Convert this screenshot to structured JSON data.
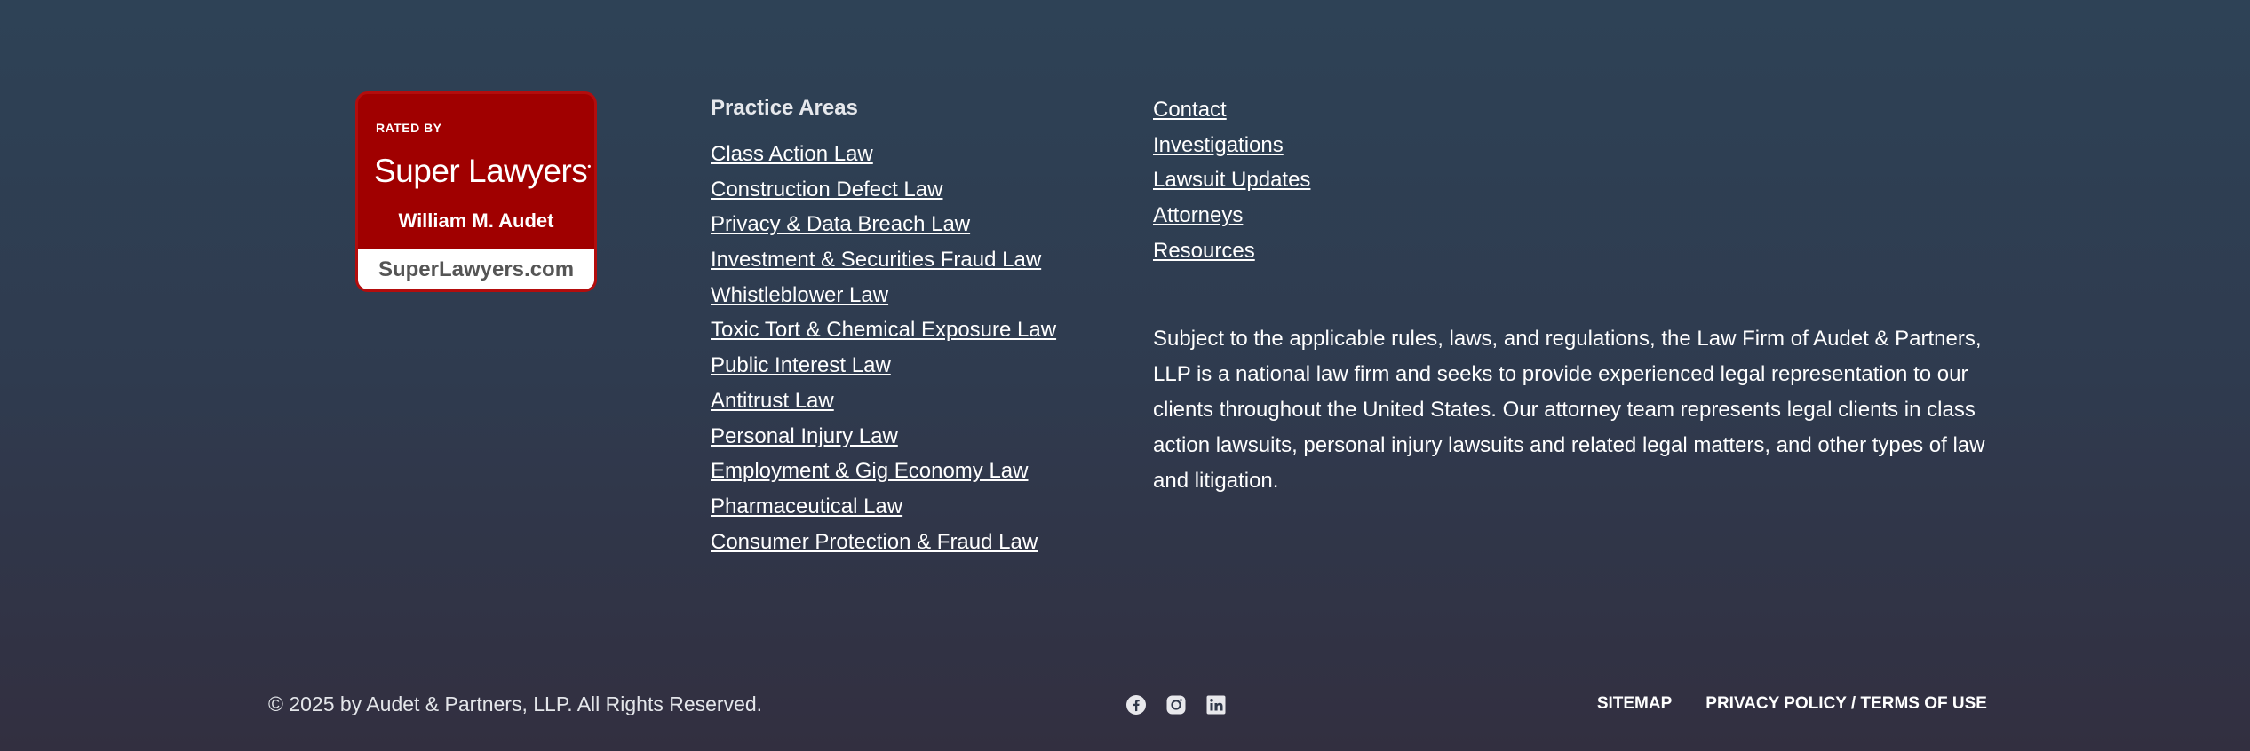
{
  "badge": {
    "rated_by": "RATED BY",
    "brand": "Super Lawyers",
    "name": "William M. Audet",
    "site": "SuperLawyers.com"
  },
  "practice_areas": {
    "heading": "Practice Areas",
    "items": [
      "Class Action Law",
      "Construction Defect Law",
      "Privacy & Data Breach Law",
      "Investment & Securities Fraud Law",
      "Whistleblower Law",
      "Toxic Tort & Chemical Exposure Law",
      "Public Interest Law",
      "Antitrust Law",
      "Personal Injury Law",
      "Employment & Gig Economy Law",
      "Pharmaceutical Law",
      "Consumer Protection & Fraud Law"
    ]
  },
  "quick_links": [
    "Contact",
    "Investigations",
    "Lawsuit Updates",
    "Attorneys",
    "Resources"
  ],
  "disclaimer": "Subject to the applicable rules, laws, and regulations, the Law Firm of Audet & Partners, LLP is a national law firm and seeks to provide experienced legal representation to our clients throughout the United States. Our attorney team represents legal clients in class action lawsuits, personal injury lawsuits and related legal matters, and other types of law and litigation.",
  "footer": {
    "copyright": "© 2025 by Audet & Partners, LLP. All Rights Reserved.",
    "social": [
      "facebook-icon",
      "instagram-icon",
      "linkedin-icon"
    ],
    "links": [
      "SITEMAP",
      "PRIVACY POLICY / TERMS OF USE"
    ]
  },
  "colors": {
    "bg_top": "#2e4256",
    "bg_bottom": "#322f40",
    "badge_red": "#a00000"
  }
}
